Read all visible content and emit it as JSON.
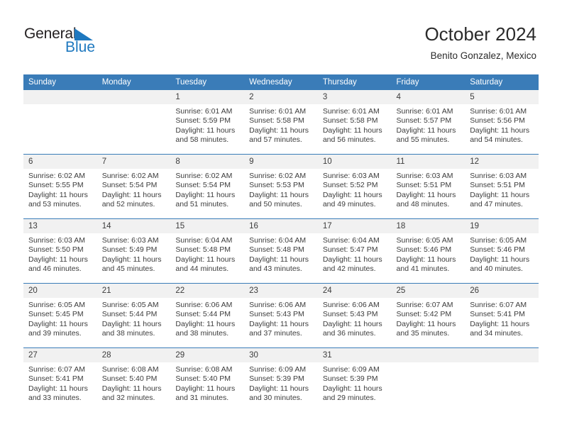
{
  "logo": {
    "word1": "General",
    "word2": "Blue",
    "triangle_color": "#1e78bf",
    "icon": "triangle-icon"
  },
  "header": {
    "title": "October 2024",
    "subtitle": "Benito Gonzalez, Mexico"
  },
  "colors": {
    "header_blue": "#3a7cb8",
    "daynum_gray": "#f1f1f1",
    "text": "#3c3c3c",
    "logo_blue": "#1e78bf"
  },
  "weekday_headers": [
    "Sunday",
    "Monday",
    "Tuesday",
    "Wednesday",
    "Thursday",
    "Friday",
    "Saturday"
  ],
  "weeks": [
    [
      {
        "day": "",
        "empty": true
      },
      {
        "day": "",
        "empty": true
      },
      {
        "day": "1",
        "sunrise": "Sunrise: 6:01 AM",
        "sunset": "Sunset: 5:59 PM",
        "daylight1": "Daylight: 11 hours",
        "daylight2": "and 58 minutes."
      },
      {
        "day": "2",
        "sunrise": "Sunrise: 6:01 AM",
        "sunset": "Sunset: 5:58 PM",
        "daylight1": "Daylight: 11 hours",
        "daylight2": "and 57 minutes."
      },
      {
        "day": "3",
        "sunrise": "Sunrise: 6:01 AM",
        "sunset": "Sunset: 5:58 PM",
        "daylight1": "Daylight: 11 hours",
        "daylight2": "and 56 minutes."
      },
      {
        "day": "4",
        "sunrise": "Sunrise: 6:01 AM",
        "sunset": "Sunset: 5:57 PM",
        "daylight1": "Daylight: 11 hours",
        "daylight2": "and 55 minutes."
      },
      {
        "day": "5",
        "sunrise": "Sunrise: 6:01 AM",
        "sunset": "Sunset: 5:56 PM",
        "daylight1": "Daylight: 11 hours",
        "daylight2": "and 54 minutes."
      }
    ],
    [
      {
        "day": "6",
        "sunrise": "Sunrise: 6:02 AM",
        "sunset": "Sunset: 5:55 PM",
        "daylight1": "Daylight: 11 hours",
        "daylight2": "and 53 minutes."
      },
      {
        "day": "7",
        "sunrise": "Sunrise: 6:02 AM",
        "sunset": "Sunset: 5:54 PM",
        "daylight1": "Daylight: 11 hours",
        "daylight2": "and 52 minutes."
      },
      {
        "day": "8",
        "sunrise": "Sunrise: 6:02 AM",
        "sunset": "Sunset: 5:54 PM",
        "daylight1": "Daylight: 11 hours",
        "daylight2": "and 51 minutes."
      },
      {
        "day": "9",
        "sunrise": "Sunrise: 6:02 AM",
        "sunset": "Sunset: 5:53 PM",
        "daylight1": "Daylight: 11 hours",
        "daylight2": "and 50 minutes."
      },
      {
        "day": "10",
        "sunrise": "Sunrise: 6:03 AM",
        "sunset": "Sunset: 5:52 PM",
        "daylight1": "Daylight: 11 hours",
        "daylight2": "and 49 minutes."
      },
      {
        "day": "11",
        "sunrise": "Sunrise: 6:03 AM",
        "sunset": "Sunset: 5:51 PM",
        "daylight1": "Daylight: 11 hours",
        "daylight2": "and 48 minutes."
      },
      {
        "day": "12",
        "sunrise": "Sunrise: 6:03 AM",
        "sunset": "Sunset: 5:51 PM",
        "daylight1": "Daylight: 11 hours",
        "daylight2": "and 47 minutes."
      }
    ],
    [
      {
        "day": "13",
        "sunrise": "Sunrise: 6:03 AM",
        "sunset": "Sunset: 5:50 PM",
        "daylight1": "Daylight: 11 hours",
        "daylight2": "and 46 minutes."
      },
      {
        "day": "14",
        "sunrise": "Sunrise: 6:03 AM",
        "sunset": "Sunset: 5:49 PM",
        "daylight1": "Daylight: 11 hours",
        "daylight2": "and 45 minutes."
      },
      {
        "day": "15",
        "sunrise": "Sunrise: 6:04 AM",
        "sunset": "Sunset: 5:48 PM",
        "daylight1": "Daylight: 11 hours",
        "daylight2": "and 44 minutes."
      },
      {
        "day": "16",
        "sunrise": "Sunrise: 6:04 AM",
        "sunset": "Sunset: 5:48 PM",
        "daylight1": "Daylight: 11 hours",
        "daylight2": "and 43 minutes."
      },
      {
        "day": "17",
        "sunrise": "Sunrise: 6:04 AM",
        "sunset": "Sunset: 5:47 PM",
        "daylight1": "Daylight: 11 hours",
        "daylight2": "and 42 minutes."
      },
      {
        "day": "18",
        "sunrise": "Sunrise: 6:05 AM",
        "sunset": "Sunset: 5:46 PM",
        "daylight1": "Daylight: 11 hours",
        "daylight2": "and 41 minutes."
      },
      {
        "day": "19",
        "sunrise": "Sunrise: 6:05 AM",
        "sunset": "Sunset: 5:46 PM",
        "daylight1": "Daylight: 11 hours",
        "daylight2": "and 40 minutes."
      }
    ],
    [
      {
        "day": "20",
        "sunrise": "Sunrise: 6:05 AM",
        "sunset": "Sunset: 5:45 PM",
        "daylight1": "Daylight: 11 hours",
        "daylight2": "and 39 minutes."
      },
      {
        "day": "21",
        "sunrise": "Sunrise: 6:05 AM",
        "sunset": "Sunset: 5:44 PM",
        "daylight1": "Daylight: 11 hours",
        "daylight2": "and 38 minutes."
      },
      {
        "day": "22",
        "sunrise": "Sunrise: 6:06 AM",
        "sunset": "Sunset: 5:44 PM",
        "daylight1": "Daylight: 11 hours",
        "daylight2": "and 38 minutes."
      },
      {
        "day": "23",
        "sunrise": "Sunrise: 6:06 AM",
        "sunset": "Sunset: 5:43 PM",
        "daylight1": "Daylight: 11 hours",
        "daylight2": "and 37 minutes."
      },
      {
        "day": "24",
        "sunrise": "Sunrise: 6:06 AM",
        "sunset": "Sunset: 5:43 PM",
        "daylight1": "Daylight: 11 hours",
        "daylight2": "and 36 minutes."
      },
      {
        "day": "25",
        "sunrise": "Sunrise: 6:07 AM",
        "sunset": "Sunset: 5:42 PM",
        "daylight1": "Daylight: 11 hours",
        "daylight2": "and 35 minutes."
      },
      {
        "day": "26",
        "sunrise": "Sunrise: 6:07 AM",
        "sunset": "Sunset: 5:41 PM",
        "daylight1": "Daylight: 11 hours",
        "daylight2": "and 34 minutes."
      }
    ],
    [
      {
        "day": "27",
        "sunrise": "Sunrise: 6:07 AM",
        "sunset": "Sunset: 5:41 PM",
        "daylight1": "Daylight: 11 hours",
        "daylight2": "and 33 minutes."
      },
      {
        "day": "28",
        "sunrise": "Sunrise: 6:08 AM",
        "sunset": "Sunset: 5:40 PM",
        "daylight1": "Daylight: 11 hours",
        "daylight2": "and 32 minutes."
      },
      {
        "day": "29",
        "sunrise": "Sunrise: 6:08 AM",
        "sunset": "Sunset: 5:40 PM",
        "daylight1": "Daylight: 11 hours",
        "daylight2": "and 31 minutes."
      },
      {
        "day": "30",
        "sunrise": "Sunrise: 6:09 AM",
        "sunset": "Sunset: 5:39 PM",
        "daylight1": "Daylight: 11 hours",
        "daylight2": "and 30 minutes."
      },
      {
        "day": "31",
        "sunrise": "Sunrise: 6:09 AM",
        "sunset": "Sunset: 5:39 PM",
        "daylight1": "Daylight: 11 hours",
        "daylight2": "and 29 minutes."
      },
      {
        "day": "",
        "empty": true
      },
      {
        "day": "",
        "empty": true
      }
    ]
  ]
}
